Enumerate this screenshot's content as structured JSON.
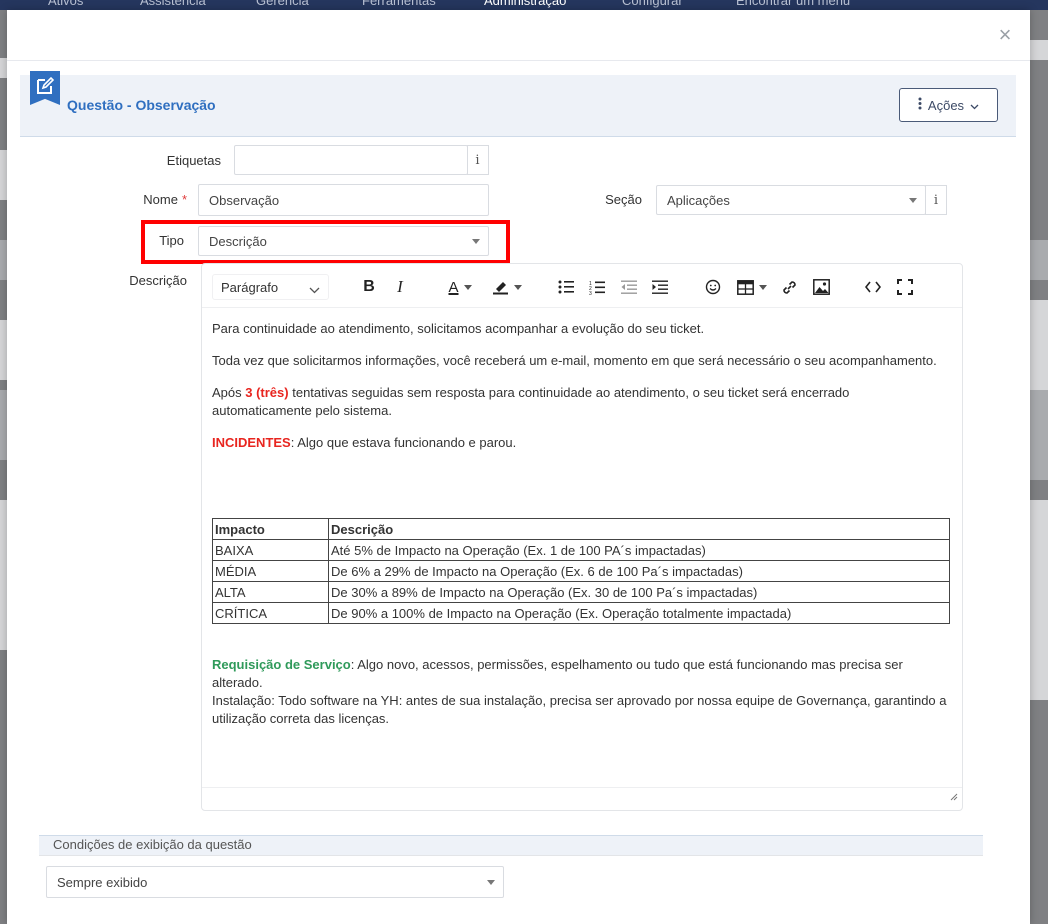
{
  "topnav": {
    "items": [
      "Ativos",
      "Assistência",
      "Gerência",
      "Ferramentas",
      "Administração",
      "Configurar",
      "Encontrar um menu"
    ]
  },
  "modal": {
    "title": "Questão - Observação",
    "actions_label": "Ações",
    "close_glyph": "×"
  },
  "form": {
    "etiquetas": {
      "label": "Etiquetas",
      "value": ""
    },
    "nome": {
      "label": "Nome",
      "required_mark": "*",
      "value": "Observação"
    },
    "secao": {
      "label": "Seção",
      "value": "Aplicações"
    },
    "tipo": {
      "label": "Tipo",
      "value": "Descrição"
    },
    "descricao": {
      "label": "Descrição"
    },
    "info_glyph": "i"
  },
  "editor": {
    "paragraph_style": "Parágrafo",
    "bold_glyph": "B",
    "italic_glyph": "I",
    "font_color_glyph": "A",
    "p1": "Para continuidade ao atendimento, solicitamos acompanhar a evolução do seu ticket.",
    "p2": "Toda vez que solicitarmos informações, você receberá um e-mail, momento em que será necessário o seu acompanhamento.",
    "p3_before": "Após ",
    "p3_highlight": "3 (três)",
    "p3_after": " tentativas seguidas sem resposta para continuidade ao atendimento, o seu ticket será encerrado automaticamente pelo sistema.",
    "incidentes_label": "INCIDENTES",
    "incidentes_text": ": Algo que estava funcionando e parou.",
    "table": {
      "headers": [
        "Impacto",
        "Descrição"
      ],
      "rows": [
        [
          "BAIXA",
          "Até 5% de Impacto na Operação (Ex. 1 de 100 PA´s impactadas)"
        ],
        [
          "MÉDIA",
          "De 6% a 29% de Impacto na Operação (Ex. 6 de 100 Pa´s impactadas)"
        ],
        [
          "ALTA",
          "De 30% a 89% de Impacto na Operação (Ex. 30 de 100 Pa´s impactadas)"
        ],
        [
          "CRÍTICA",
          "De 90% a 100% de Impacto na Operação (Ex. Operação totalmente impactada)"
        ]
      ]
    },
    "requisicao_label": "Requisição de Serviço",
    "requisicao_text": ": Algo novo, acessos, permissões, espelhamento ou tudo que está funcionando mas precisa ser alterado.",
    "instalacao_text": "Instalação: Todo software na YH: antes de sua instalação, precisa ser aprovado por nossa equipe de Governança, garantindo a utilização correta das licenças."
  },
  "conditions": {
    "title": "Condições de exibição da questão",
    "value": "Sempre exibido"
  },
  "colors": {
    "accent": "#2f6fc0",
    "highlight_red": "#ff0000",
    "text_red": "#e8251f",
    "text_green": "#2f9a5a"
  }
}
